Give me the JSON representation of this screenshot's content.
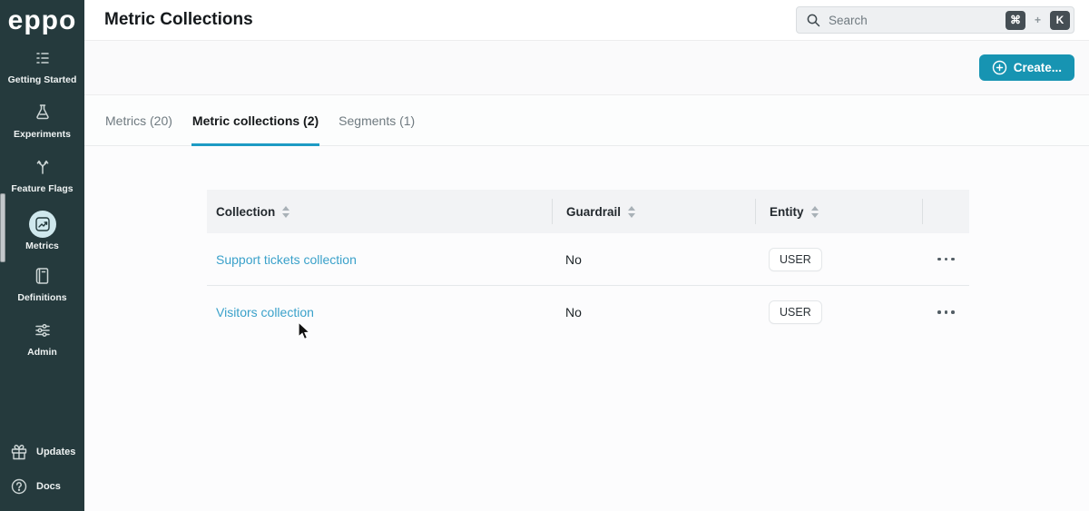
{
  "app": {
    "logo_text": "eppo"
  },
  "sidebar": {
    "items": [
      {
        "label": "Getting Started"
      },
      {
        "label": "Experiments"
      },
      {
        "label": "Feature Flags"
      },
      {
        "label": "Metrics",
        "active": true
      },
      {
        "label": "Definitions"
      },
      {
        "label": "Admin"
      }
    ],
    "footer_items": [
      {
        "label": "Updates"
      },
      {
        "label": "Docs"
      }
    ]
  },
  "header": {
    "title": "Metric Collections",
    "search": {
      "placeholder": "Search",
      "shortcut_mod": "⌘",
      "shortcut_plus": "+",
      "shortcut_key": "K"
    }
  },
  "actions": {
    "create_label": "Create..."
  },
  "tabs": [
    {
      "label": "Metrics (20)",
      "active": false
    },
    {
      "label": "Metric collections (2)",
      "active": true
    },
    {
      "label": "Segments (1)",
      "active": false
    }
  ],
  "table": {
    "columns": [
      {
        "label": "Collection",
        "sortable": true
      },
      {
        "label": "Guardrail",
        "sortable": true
      },
      {
        "label": "Entity",
        "sortable": true
      }
    ],
    "rows": [
      {
        "collection": "Support tickets collection",
        "guardrail": "No",
        "entity": "USER"
      },
      {
        "collection": "Visitors collection",
        "guardrail": "No",
        "entity": "USER"
      }
    ]
  },
  "colors": {
    "sidebar_bg": "#253a3d",
    "accent_teal": "#1794b2",
    "tab_underline": "#1d9bc4",
    "link_blue": "#3aa1ca",
    "table_header_bg": "#f2f3f5"
  }
}
